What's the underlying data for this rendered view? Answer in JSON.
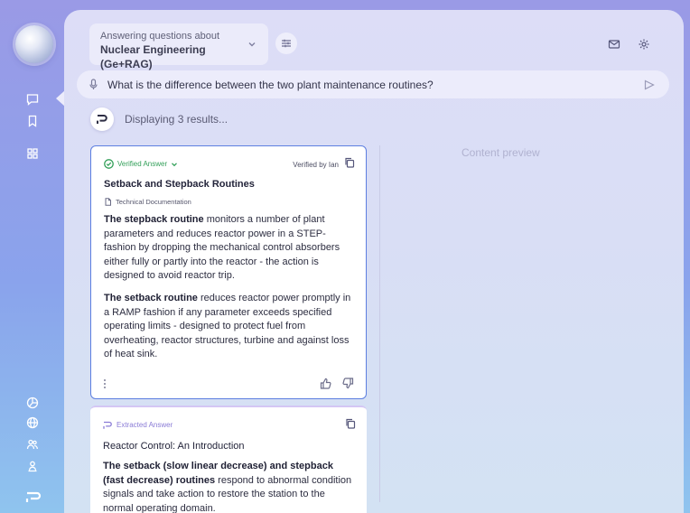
{
  "context": {
    "line1": "Answering questions about",
    "line2": "Nuclear Engineering (Ge+RAG)"
  },
  "query": {
    "text": "What is the difference between the two plant maintenance routines?"
  },
  "status": {
    "text": "Displaying 3 results..."
  },
  "preview": {
    "label": "Content preview"
  },
  "cards": [
    {
      "badge": "Verified Answer",
      "verified_by": "Verified by Ian",
      "title": "Setback and Stepback Routines",
      "source": "Technical Documentation",
      "p1_bold": "The stepback routine",
      "p1_rest": " monitors a number of plant parameters and reduces reactor power in a STEP-fashion by dropping the mechanical control absorbers either fully or partly into the reactor - the action is designed to avoid reactor trip.",
      "p2_bold": "The setback routine",
      "p2_rest": " reduces reactor power promptly in a RAMP fashion if any parameter exceeds specified operating limits - designed to protect fuel from overheating, reactor structures, turbine and against loss of heat sink."
    },
    {
      "badge": "Extracted Answer",
      "title": "Reactor Control: An Introduction",
      "p1_bold": "The setback (slow linear decrease) and stepback (fast decrease) routines",
      "p1_rest": " respond to abnormal condition signals and take action to restore the station to the normal operating domain."
    }
  ],
  "icons": {
    "rail": [
      "chat-icon",
      "bookmark-icon",
      "grid-icon",
      "chart-pie-icon",
      "globe-icon",
      "users-icon",
      "user-icon",
      "brand-logo-icon"
    ],
    "top": [
      "mail-icon",
      "settings-gear-icon"
    ]
  },
  "colors": {
    "verified": "#34a05a",
    "extracted": "#8a7bd6",
    "card_border": "#5d7fe0"
  }
}
